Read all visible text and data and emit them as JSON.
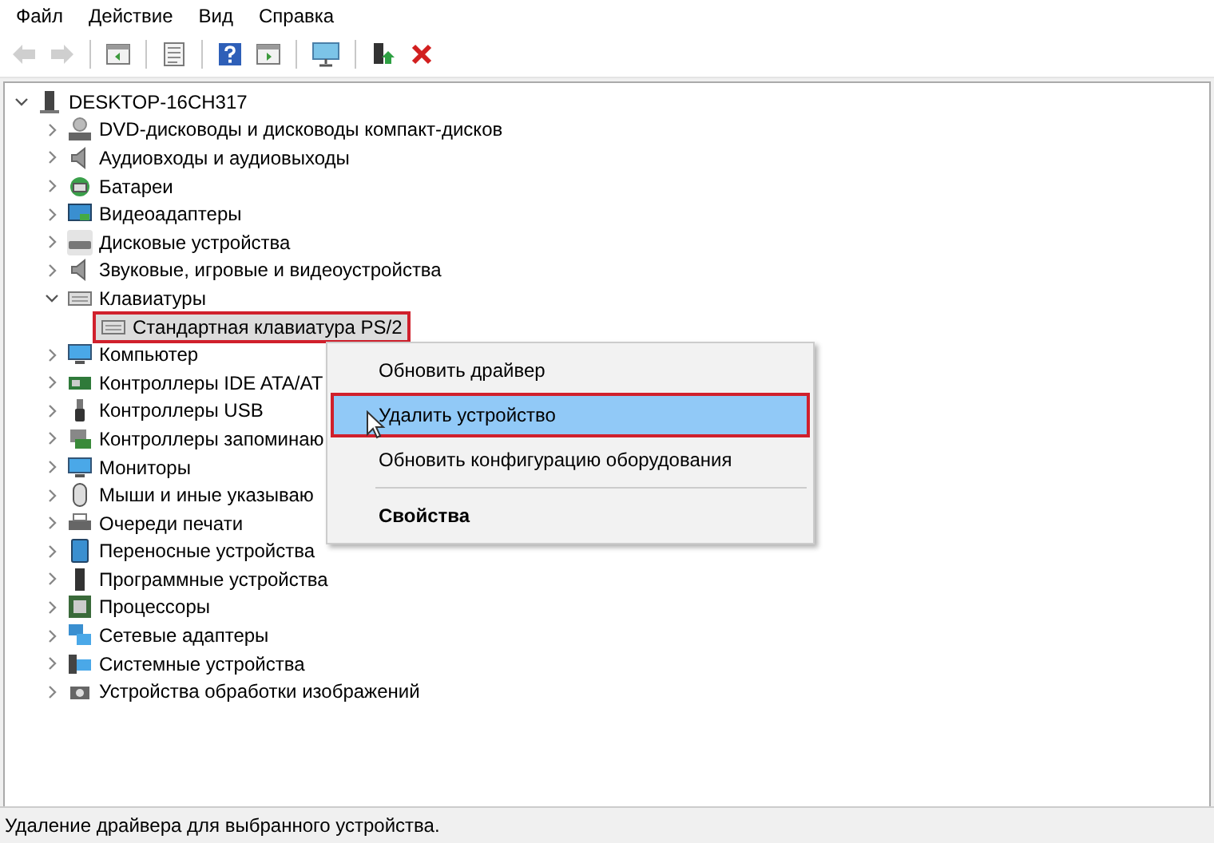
{
  "menu_bar": [
    {
      "label": "Файл"
    },
    {
      "label": "Действие"
    },
    {
      "label": "Вид"
    },
    {
      "label": "Справка"
    }
  ],
  "toolbar": [
    {
      "kind": "back",
      "disabled": true
    },
    {
      "kind": "forward",
      "disabled": true
    },
    {
      "kind": "panel",
      "disabled": false
    },
    {
      "kind": "properties",
      "disabled": false
    },
    {
      "kind": "help",
      "disabled": false
    },
    {
      "kind": "panel2",
      "disabled": false
    },
    {
      "kind": "monitor",
      "disabled": false
    },
    {
      "kind": "add-driver",
      "disabled": false
    },
    {
      "kind": "remove",
      "disabled": false
    }
  ],
  "tree": {
    "label": "DESKTOP-16CH317",
    "expanded": true,
    "children": [
      {
        "label": "DVD-дисководы и дисководы компакт-дисков",
        "expanded": false
      },
      {
        "label": "Аудиовходы и аудиовыходы",
        "expanded": false
      },
      {
        "label": "Батареи",
        "expanded": false
      },
      {
        "label": "Видеоадаптеры",
        "expanded": false
      },
      {
        "label": "Дисковые устройства",
        "expanded": false
      },
      {
        "label": "Звуковые, игровые и видеоустройства",
        "expanded": false
      },
      {
        "label": "Клавиатуры",
        "expanded": true,
        "children": [
          {
            "label": "Стандартная клавиатура PS/2",
            "selected": true,
            "highlight": true
          }
        ]
      },
      {
        "label": "Компьютер",
        "expanded": false
      },
      {
        "label": "Контроллеры IDE ATA/AT",
        "expanded": false
      },
      {
        "label": "Контроллеры USB",
        "expanded": false
      },
      {
        "label": "Контроллеры запоминаю",
        "expanded": false
      },
      {
        "label": "Мониторы",
        "expanded": false
      },
      {
        "label": "Мыши и иные указываю",
        "expanded": false
      },
      {
        "label": "Очереди печати",
        "expanded": false
      },
      {
        "label": "Переносные устройства",
        "expanded": false
      },
      {
        "label": "Программные устройства",
        "expanded": false
      },
      {
        "label": "Процессоры",
        "expanded": false
      },
      {
        "label": "Сетевые адаптеры",
        "expanded": false
      },
      {
        "label": "Системные устройства",
        "expanded": false
      },
      {
        "label": "Устройства обработки изображений",
        "expanded": false
      }
    ]
  },
  "context_menu": [
    {
      "kind": "item",
      "label": "Обновить драйвер",
      "selected": false,
      "highlight": false
    },
    {
      "kind": "item",
      "label": "Удалить устройство",
      "selected": true,
      "highlight": true
    },
    {
      "kind": "item",
      "label": "Обновить конфигурацию оборудования",
      "selected": false,
      "highlight": false
    },
    {
      "kind": "separator"
    },
    {
      "kind": "bold",
      "label": "Свойства",
      "selected": false,
      "highlight": false
    }
  ],
  "status_bar": "Удаление драйвера для выбранного устройства."
}
